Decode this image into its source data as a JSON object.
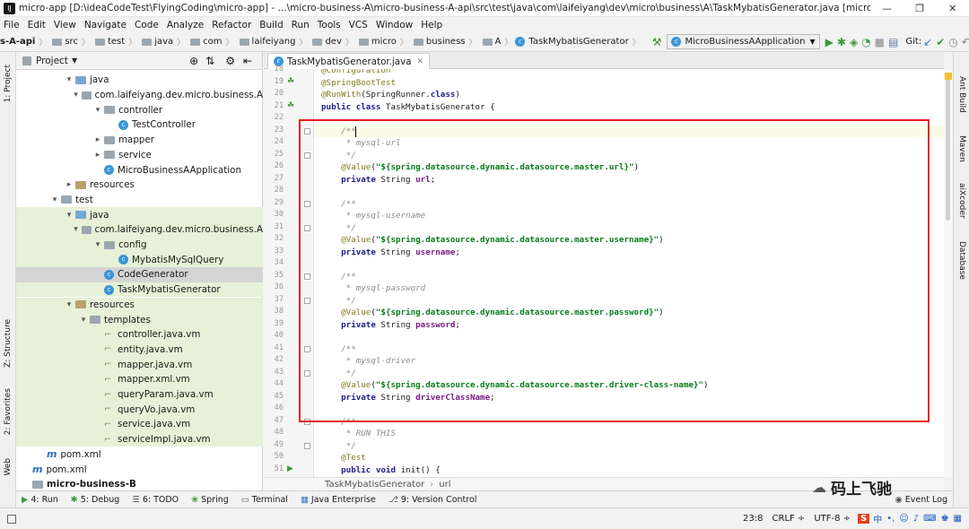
{
  "titlebar": {
    "title": "micro-app [D:\\ideaCodeTest\\FlyingCoding\\micro-app] - ...\\micro-business-A\\micro-business-A-api\\src\\test\\java\\com\\laifeiyang\\dev\\micro\\business\\A\\TaskMybatisGenerator.java [micro-business-A-api] - I...",
    "min": "—",
    "max": "❐",
    "close": "✕"
  },
  "menu": [
    "File",
    "Edit",
    "View",
    "Navigate",
    "Code",
    "Analyze",
    "Refactor",
    "Build",
    "Run",
    "Tools",
    "VCS",
    "Window",
    "Help"
  ],
  "navbar": {
    "crumbs": [
      "s-A-api",
      "src",
      "test",
      "java",
      "com",
      "laifeiyang",
      "dev",
      "micro",
      "business",
      "A",
      "TaskMybatisGenerator"
    ],
    "run_config": "MicroBusinessAApplication",
    "git_label": "Git:"
  },
  "project_panel": {
    "header": "Project",
    "rows": [
      {
        "label": "java",
        "indent": 3,
        "arrow": "▾",
        "icon": "folder-blue",
        "style": ""
      },
      {
        "label": "com.laifeiyang.dev.micro.business.A",
        "indent": 4,
        "arrow": "▾",
        "icon": "folder",
        "style": ""
      },
      {
        "label": "controller",
        "indent": 5,
        "arrow": "▾",
        "icon": "folder",
        "style": ""
      },
      {
        "label": "TestController",
        "indent": 6,
        "arrow": "",
        "icon": "class",
        "style": ""
      },
      {
        "label": "mapper",
        "indent": 5,
        "arrow": "▸",
        "icon": "folder",
        "style": ""
      },
      {
        "label": "service",
        "indent": 5,
        "arrow": "▸",
        "icon": "folder",
        "style": ""
      },
      {
        "label": "MicroBusinessAApplication",
        "indent": 5,
        "arrow": "",
        "icon": "class",
        "style": ""
      },
      {
        "label": "resources",
        "indent": 3,
        "arrow": "▸",
        "icon": "folder-res",
        "style": ""
      },
      {
        "label": "test",
        "indent": 2,
        "arrow": "▾",
        "icon": "folder",
        "style": ""
      },
      {
        "label": "java",
        "indent": 3,
        "arrow": "▾",
        "icon": "folder-blue",
        "style": "green"
      },
      {
        "label": "com.laifeiyang.dev.micro.business.A",
        "indent": 4,
        "arrow": "▾",
        "icon": "folder",
        "style": "green"
      },
      {
        "label": "config",
        "indent": 5,
        "arrow": "▾",
        "icon": "folder",
        "style": "green"
      },
      {
        "label": "MybatisMySqlQuery",
        "indent": 6,
        "arrow": "",
        "icon": "class",
        "style": "green"
      },
      {
        "label": "CodeGenerator",
        "indent": 5,
        "arrow": "",
        "icon": "class",
        "style": "sel"
      },
      {
        "label": "TaskMybatisGenerator",
        "indent": 5,
        "arrow": "",
        "icon": "class",
        "style": "green"
      },
      {
        "label": "resources",
        "indent": 3,
        "arrow": "▾",
        "icon": "folder-res",
        "style": "green"
      },
      {
        "label": "templates",
        "indent": 4,
        "arrow": "▾",
        "icon": "folder",
        "style": "green"
      },
      {
        "label": "controller.java.vm",
        "indent": 5,
        "arrow": "",
        "icon": "tpl",
        "style": "green"
      },
      {
        "label": "entity.java.vm",
        "indent": 5,
        "arrow": "",
        "icon": "tpl",
        "style": "green"
      },
      {
        "label": "mapper.java.vm",
        "indent": 5,
        "arrow": "",
        "icon": "tpl",
        "style": "green"
      },
      {
        "label": "mapper.xml.vm",
        "indent": 5,
        "arrow": "",
        "icon": "tpl",
        "style": "green"
      },
      {
        "label": "queryParam.java.vm",
        "indent": 5,
        "arrow": "",
        "icon": "tpl",
        "style": "green"
      },
      {
        "label": "queryVo.java.vm",
        "indent": 5,
        "arrow": "",
        "icon": "tpl",
        "style": "green"
      },
      {
        "label": "service.java.vm",
        "indent": 5,
        "arrow": "",
        "icon": "tpl",
        "style": "green"
      },
      {
        "label": "serviceImpl.java.vm",
        "indent": 5,
        "arrow": "",
        "icon": "tpl",
        "style": "green"
      },
      {
        "label": "pom.xml",
        "indent": 1,
        "arrow": "",
        "icon": "m",
        "style": ""
      },
      {
        "label": "pom.xml",
        "indent": 0,
        "arrow": "",
        "icon": "m",
        "style": ""
      },
      {
        "label": "micro-business-B",
        "indent": 0,
        "arrow": "",
        "icon": "folder",
        "style": "bold"
      }
    ]
  },
  "editor": {
    "tab_label": "TaskMybatisGenerator.java",
    "lines": [
      {
        "n": "18",
        "t": [
          [
            "ann",
            "@Configuration"
          ]
        ]
      },
      {
        "n": "19",
        "t": [
          [
            "ann",
            "@SpringBootTest"
          ]
        ]
      },
      {
        "n": "20",
        "t": [
          [
            "ann",
            "@RunWith"
          ],
          [
            "",
            "(SpringRunner."
          ],
          [
            "kw",
            "class"
          ],
          [
            "",
            ")"
          ]
        ]
      },
      {
        "n": "21",
        "t": [
          [
            "kw",
            "public class "
          ],
          [
            "",
            "TaskMybatisGenerator {"
          ]
        ]
      },
      {
        "n": "22",
        "t": []
      },
      {
        "n": "23",
        "t": [
          [
            "cmt",
            "    /**"
          ]
        ],
        "cur": true
      },
      {
        "n": "24",
        "t": [
          [
            "cmt",
            "     * mysql-url"
          ]
        ]
      },
      {
        "n": "25",
        "t": [
          [
            "cmt",
            "     */"
          ]
        ]
      },
      {
        "n": "26",
        "t": [
          [
            "ann",
            "    @Value"
          ],
          [
            "",
            "("
          ],
          [
            "str",
            "\"${spring.datasource.dynamic.datasource.master.url}\""
          ],
          [
            "",
            ")"
          ]
        ]
      },
      {
        "n": "27",
        "t": [
          [
            "kw",
            "    private "
          ],
          [
            "",
            "String "
          ],
          [
            "fld",
            "url"
          ],
          [
            "",
            ";"
          ]
        ]
      },
      {
        "n": "28",
        "t": []
      },
      {
        "n": "29",
        "t": [
          [
            "cmt",
            "    /**"
          ]
        ]
      },
      {
        "n": "30",
        "t": [
          [
            "cmt",
            "     * mysql-username"
          ]
        ]
      },
      {
        "n": "31",
        "t": [
          [
            "cmt",
            "     */"
          ]
        ]
      },
      {
        "n": "32",
        "t": [
          [
            "ann",
            "    @Value"
          ],
          [
            "",
            "("
          ],
          [
            "str",
            "\"${spring.datasource.dynamic.datasource.master.username}\""
          ],
          [
            "",
            ")"
          ]
        ]
      },
      {
        "n": "33",
        "t": [
          [
            "kw",
            "    private "
          ],
          [
            "",
            "String "
          ],
          [
            "fld",
            "username"
          ],
          [
            "",
            ";"
          ]
        ]
      },
      {
        "n": "34",
        "t": []
      },
      {
        "n": "35",
        "t": [
          [
            "cmt",
            "    /**"
          ]
        ]
      },
      {
        "n": "36",
        "t": [
          [
            "cmt",
            "     * mysql-password"
          ]
        ]
      },
      {
        "n": "37",
        "t": [
          [
            "cmt",
            "     */"
          ]
        ]
      },
      {
        "n": "38",
        "t": [
          [
            "ann",
            "    @Value"
          ],
          [
            "",
            "("
          ],
          [
            "str",
            "\"${spring.datasource.dynamic.datasource.master.password}\""
          ],
          [
            "",
            ")"
          ]
        ]
      },
      {
        "n": "39",
        "t": [
          [
            "kw",
            "    private "
          ],
          [
            "",
            "String "
          ],
          [
            "fld",
            "password"
          ],
          [
            "",
            ";"
          ]
        ]
      },
      {
        "n": "40",
        "t": []
      },
      {
        "n": "41",
        "t": [
          [
            "cmt",
            "    /**"
          ]
        ]
      },
      {
        "n": "42",
        "t": [
          [
            "cmt",
            "     * mysql-driver"
          ]
        ]
      },
      {
        "n": "43",
        "t": [
          [
            "cmt",
            "     */"
          ]
        ]
      },
      {
        "n": "44",
        "t": [
          [
            "ann",
            "    @Value"
          ],
          [
            "",
            "("
          ],
          [
            "str",
            "\"${spring.datasource.dynamic.datasource.master.driver-class-name}\""
          ],
          [
            "",
            ")"
          ]
        ]
      },
      {
        "n": "45",
        "t": [
          [
            "kw",
            "    private "
          ],
          [
            "",
            "String "
          ],
          [
            "fld",
            "driverClassName"
          ],
          [
            "",
            ";"
          ]
        ]
      },
      {
        "n": "46",
        "t": []
      },
      {
        "n": "47",
        "t": [
          [
            "cmt",
            "    /**"
          ]
        ]
      },
      {
        "n": "48",
        "t": [
          [
            "cmt",
            "     * RUN THIS"
          ]
        ]
      },
      {
        "n": "49",
        "t": [
          [
            "cmt",
            "     */"
          ]
        ]
      },
      {
        "n": "50",
        "t": [
          [
            "ann",
            "    @Test"
          ]
        ]
      },
      {
        "n": "51",
        "t": [
          [
            "kw",
            "    public void "
          ],
          [
            "",
            "init() {"
          ]
        ]
      }
    ],
    "breadcrumb": [
      "TaskMybatisGenerator",
      "url"
    ]
  },
  "left_tool_tabs": [
    "1: Project",
    "Z: Structure",
    "2: Favorites",
    "Web"
  ],
  "right_tool_tabs": [
    "Ant Build",
    "Maven",
    "aiXcoder",
    "Database"
  ],
  "bottom_tabs": [
    {
      "icon": "run-icon",
      "label": "4: Run"
    },
    {
      "icon": "debug-icon",
      "label": "5: Debug"
    },
    {
      "icon": "todo-icon",
      "label": "6: TODO"
    },
    {
      "icon": "spring-icon",
      "label": "Spring"
    },
    {
      "icon": "terminal-icon",
      "label": "Terminal"
    },
    {
      "icon": "java-enterprise-icon",
      "label": "Java Enterprise"
    },
    {
      "icon": "version-control-icon",
      "label": "9: Version Control"
    }
  ],
  "event_log": "Event Log",
  "status": {
    "position": "23:8",
    "line_sep": "CRLF ÷",
    "encoding": "UTF-8 ÷",
    "ime": "中"
  },
  "watermark": "码上飞驰"
}
